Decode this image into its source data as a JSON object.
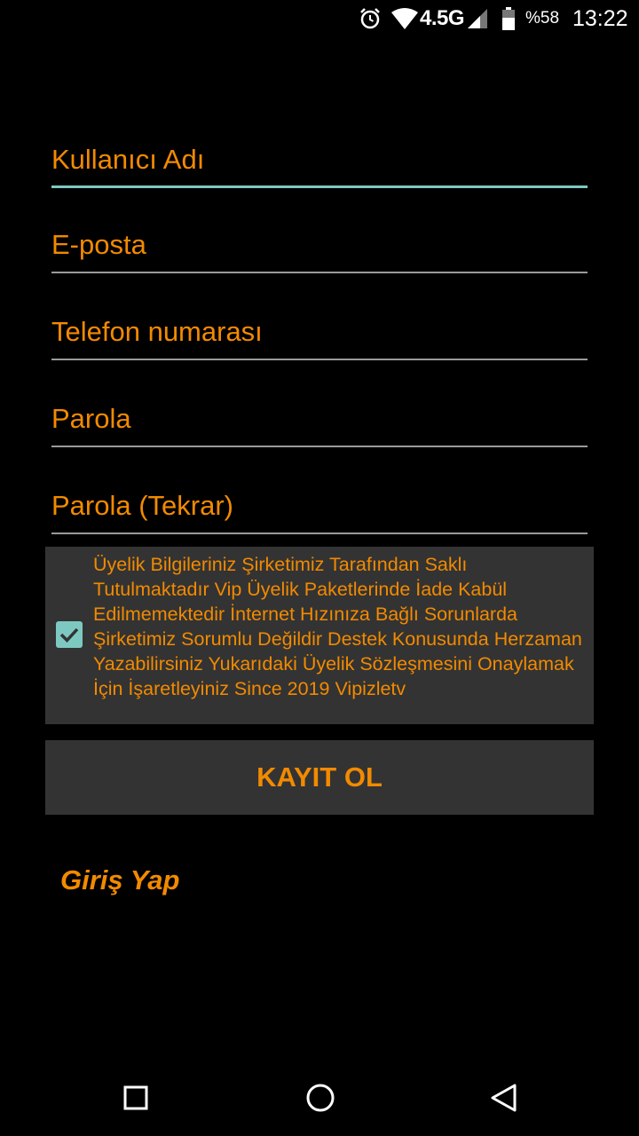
{
  "status_bar": {
    "network": "4.5G",
    "battery_percent": "%58",
    "time": "13:22",
    "icons": [
      "alarm-icon",
      "wifi-icon",
      "signal-icon",
      "battery-icon"
    ]
  },
  "form": {
    "username_placeholder": "Kullanıcı Adı",
    "email_placeholder": "E-posta",
    "phone_placeholder": "Telefon numarası",
    "password_placeholder": "Parola",
    "password_repeat_placeholder": "Parola (Tekrar)"
  },
  "terms": {
    "checked": true,
    "text": "Üyelik Bilgileriniz Şirketimiz Tarafından Saklı Tutulmaktadır Vip Üyelik Paketlerinde İade Kabül Edilmemektedir İnternet Hızınıza Bağlı Sorunlarda Şirketimiz Sorumlu Değildir Destek Konusunda Herzaman Yazabilirsiniz Yukarıdaki Üyelik Sözleşmesini Onaylamak İçin İşaretleyiniz Since 2019 Vipizletv"
  },
  "register_button": "KAYIT OL",
  "login_link": "Giriş Yap",
  "nav": {
    "icons": [
      "recent-apps-icon",
      "home-icon",
      "back-icon"
    ]
  },
  "colors": {
    "accent": "#f28a00",
    "focus_underline": "#7ec8c2",
    "panel": "#333333",
    "background": "#000000"
  }
}
